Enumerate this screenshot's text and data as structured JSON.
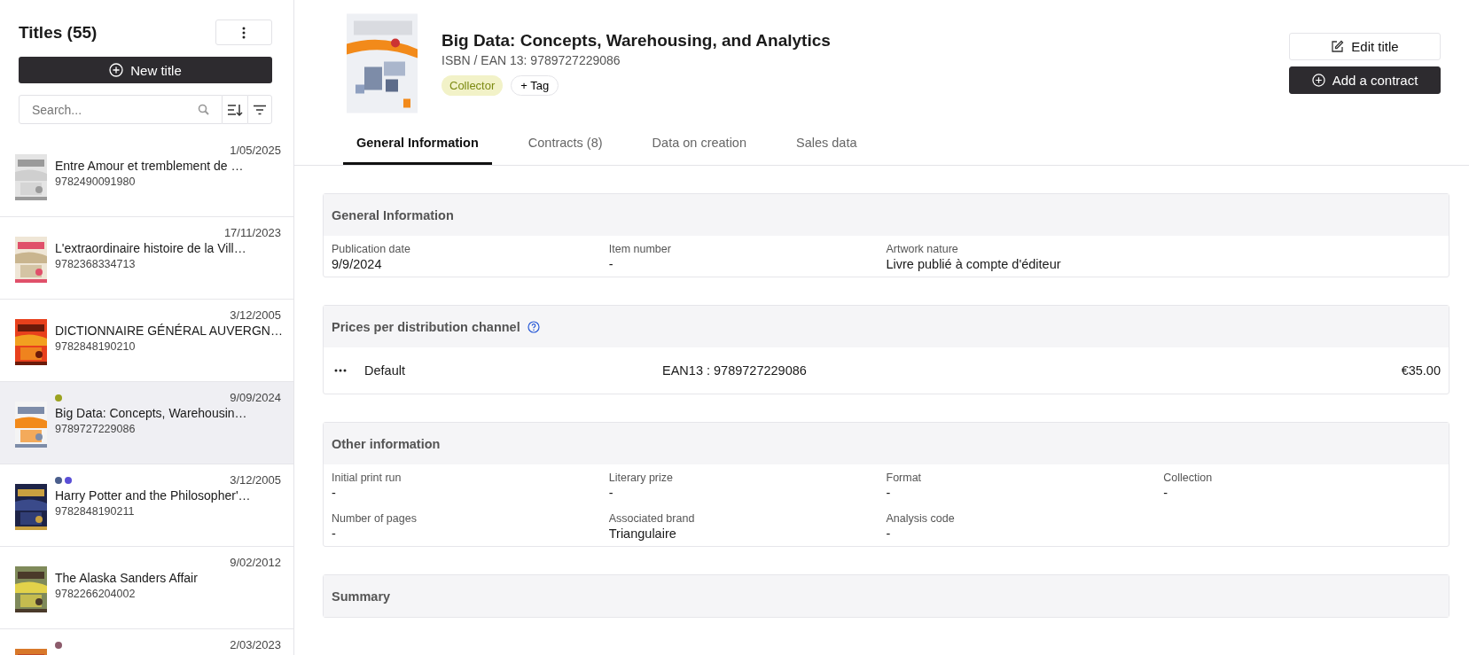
{
  "sidebar": {
    "title": "Titles (55)",
    "new_title_button": "New title",
    "search": {
      "placeholder": "Search..."
    },
    "items": [
      {
        "date": "1/05/2025",
        "title": "Entre Amour et tremblement de …",
        "isbn": "9782490091980",
        "selected": false
      },
      {
        "date": "17/11/2023",
        "title": "L'extraordinaire histoire de la Vill…",
        "isbn": "9782368334713",
        "selected": false
      },
      {
        "date": "3/12/2005",
        "title": "DICTIONNAIRE GÉNÉRAL AUVERGN…",
        "isbn": "9782848190210",
        "selected": false
      },
      {
        "date": "9/09/2024",
        "title": "Big Data: Concepts, Warehousin…",
        "isbn": "9789727229086",
        "selected": true,
        "dots": [
          {
            "color": "#9ba21f"
          }
        ]
      },
      {
        "date": "3/12/2005",
        "title": "Harry Potter and the Philosopher'…",
        "isbn": "9782848190211",
        "selected": false,
        "dots": [
          {
            "color": "#4a5e8c"
          },
          {
            "color": "#5a4fd6"
          }
        ]
      },
      {
        "date": "9/02/2012",
        "title": "The Alaska Sanders Affair",
        "isbn": "9782266204002",
        "selected": false
      },
      {
        "date": "2/03/2023",
        "selected": false,
        "dots": [
          {
            "color": "#8c5b6b"
          }
        ]
      }
    ]
  },
  "header": {
    "title": "Big Data: Concepts, Warehousing, and Analytics",
    "isbn": "ISBN / EAN 13: 9789727229086",
    "tags": [
      "Collector"
    ],
    "add_tag": "+ Tag",
    "buttons": [
      {
        "label": "Edit title",
        "kind": "edit"
      },
      {
        "label": "Add a contract",
        "kind": "add"
      }
    ]
  },
  "tabs": [
    {
      "label": "General Information",
      "selected": true
    },
    {
      "label": "Contracts (8)",
      "selected": false
    },
    {
      "label": "Data on creation",
      "selected": false
    },
    {
      "label": "Sales data",
      "selected": false
    }
  ],
  "sections": [
    {
      "kind": "fields",
      "title": "General Information",
      "fields": [
        {
          "label": "Publication date",
          "value": "9/9/2024"
        },
        {
          "label": "Item number",
          "value": "-"
        },
        {
          "label": "Artwork nature",
          "value": "Livre publié à compte d'éditeur"
        }
      ]
    },
    {
      "kind": "prices",
      "title": "Prices per distribution channel",
      "rows": [
        {
          "channel": "Default",
          "ean": "EAN13 : 9789727229086",
          "price": "€35.00"
        }
      ]
    },
    {
      "kind": "fields",
      "title": "Other information",
      "fields": [
        {
          "label": "Initial print run",
          "value": "-"
        },
        {
          "label": "Literary prize",
          "value": "-"
        },
        {
          "label": "Format",
          "value": "-"
        },
        {
          "label": "Collection",
          "value": "-"
        },
        {
          "label": "Number of pages",
          "value": "-"
        },
        {
          "label": "Associated brand",
          "value": "Triangulaire"
        },
        {
          "label": "Analysis code",
          "value": "-"
        }
      ]
    },
    {
      "kind": "empty",
      "title": "Summary"
    }
  ]
}
